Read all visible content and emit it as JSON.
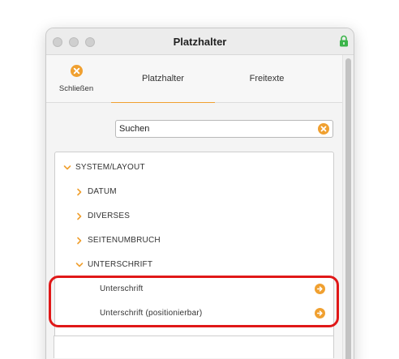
{
  "window": {
    "title": "Platzhalter"
  },
  "toolbar": {
    "close_label": "Schließen",
    "tabs": [
      {
        "label": "Platzhalter",
        "active": true
      },
      {
        "label": "Freitexte",
        "active": false
      }
    ]
  },
  "search": {
    "value": "Suchen"
  },
  "tree": {
    "items": [
      {
        "label": "SYSTEM/LAYOUT",
        "expanded": true
      },
      {
        "label": "DATUM",
        "expanded": false
      },
      {
        "label": "DIVERSES",
        "expanded": false
      },
      {
        "label": "SEITENUMBRUCH",
        "expanded": false
      },
      {
        "label": "UNTERSCHRIFT",
        "expanded": true
      },
      {
        "label": "Unterschrift"
      },
      {
        "label": "Unterschrift (positionierbar)"
      }
    ]
  },
  "colors": {
    "accent": "#f0a030",
    "highlight": "#e01818",
    "lock": "#3bb54a"
  }
}
